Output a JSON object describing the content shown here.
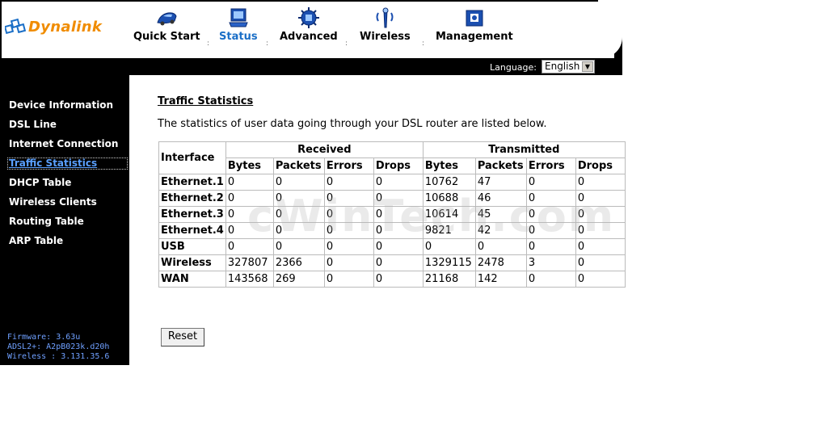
{
  "brand": {
    "name": "Dynalink"
  },
  "nav": {
    "items": [
      {
        "label": "Quick Start",
        "icon": "car-icon",
        "active": false
      },
      {
        "label": "Status",
        "icon": "monitor-icon",
        "active": true
      },
      {
        "label": "Advanced",
        "icon": "chip-icon",
        "active": false
      },
      {
        "label": "Wireless",
        "icon": "antenna-icon",
        "active": false
      },
      {
        "label": "Management",
        "icon": "toolbox-icon",
        "active": false
      }
    ]
  },
  "language": {
    "label": "Language:",
    "selected": "English"
  },
  "sidebar": {
    "items": [
      {
        "label": "Device Information"
      },
      {
        "label": "DSL Line"
      },
      {
        "label": "Internet Connection"
      },
      {
        "label": "Traffic Statistics",
        "active": true
      },
      {
        "label": "DHCP Table"
      },
      {
        "label": "Wireless Clients"
      },
      {
        "label": "Routing Table"
      },
      {
        "label": "ARP Table"
      }
    ],
    "firmware": {
      "firmware": "Firmware:  3.63u",
      "adsl": "ADSL2+:  A2pB023k.d20h",
      "wireless": "Wireless :  3.131.35.6"
    }
  },
  "main": {
    "title": "Traffic Statistics",
    "description": "The statistics of user data going through your DSL router are listed below.",
    "table": {
      "interface_header": "Interface",
      "received_header": "Received",
      "transmitted_header": "Transmitted",
      "sub_headers": [
        "Bytes",
        "Packets",
        "Errors",
        "Drops",
        "Bytes",
        "Packets",
        "Errors",
        "Drops"
      ],
      "rows": [
        {
          "iface": "Ethernet.1",
          "values": [
            "0",
            "0",
            "0",
            "0",
            "10762",
            "47",
            "0",
            "0"
          ]
        },
        {
          "iface": "Ethernet.2",
          "values": [
            "0",
            "0",
            "0",
            "0",
            "10688",
            "46",
            "0",
            "0"
          ]
        },
        {
          "iface": "Ethernet.3",
          "values": [
            "0",
            "0",
            "0",
            "0",
            "10614",
            "45",
            "0",
            "0"
          ]
        },
        {
          "iface": "Ethernet.4",
          "values": [
            "0",
            "0",
            "0",
            "0",
            "9821",
            "42",
            "0",
            "0"
          ]
        },
        {
          "iface": "USB",
          "values": [
            "0",
            "0",
            "0",
            "0",
            "0",
            "0",
            "0",
            "0"
          ]
        },
        {
          "iface": "Wireless",
          "values": [
            "327807",
            "2366",
            "0",
            "0",
            "1329115",
            "2478",
            "3",
            "0"
          ]
        },
        {
          "iface": "WAN",
          "values": [
            "143568",
            "269",
            "0",
            "0",
            "21168",
            "142",
            "0",
            "0"
          ]
        }
      ]
    },
    "reset_label": "Reset",
    "watermark": "cWinTech.com"
  },
  "colors": {
    "accent": "#1b6fc7",
    "brand_orange": "#f08c00",
    "sidebar_bg": "#000000",
    "link_active": "#5aa0ff"
  }
}
